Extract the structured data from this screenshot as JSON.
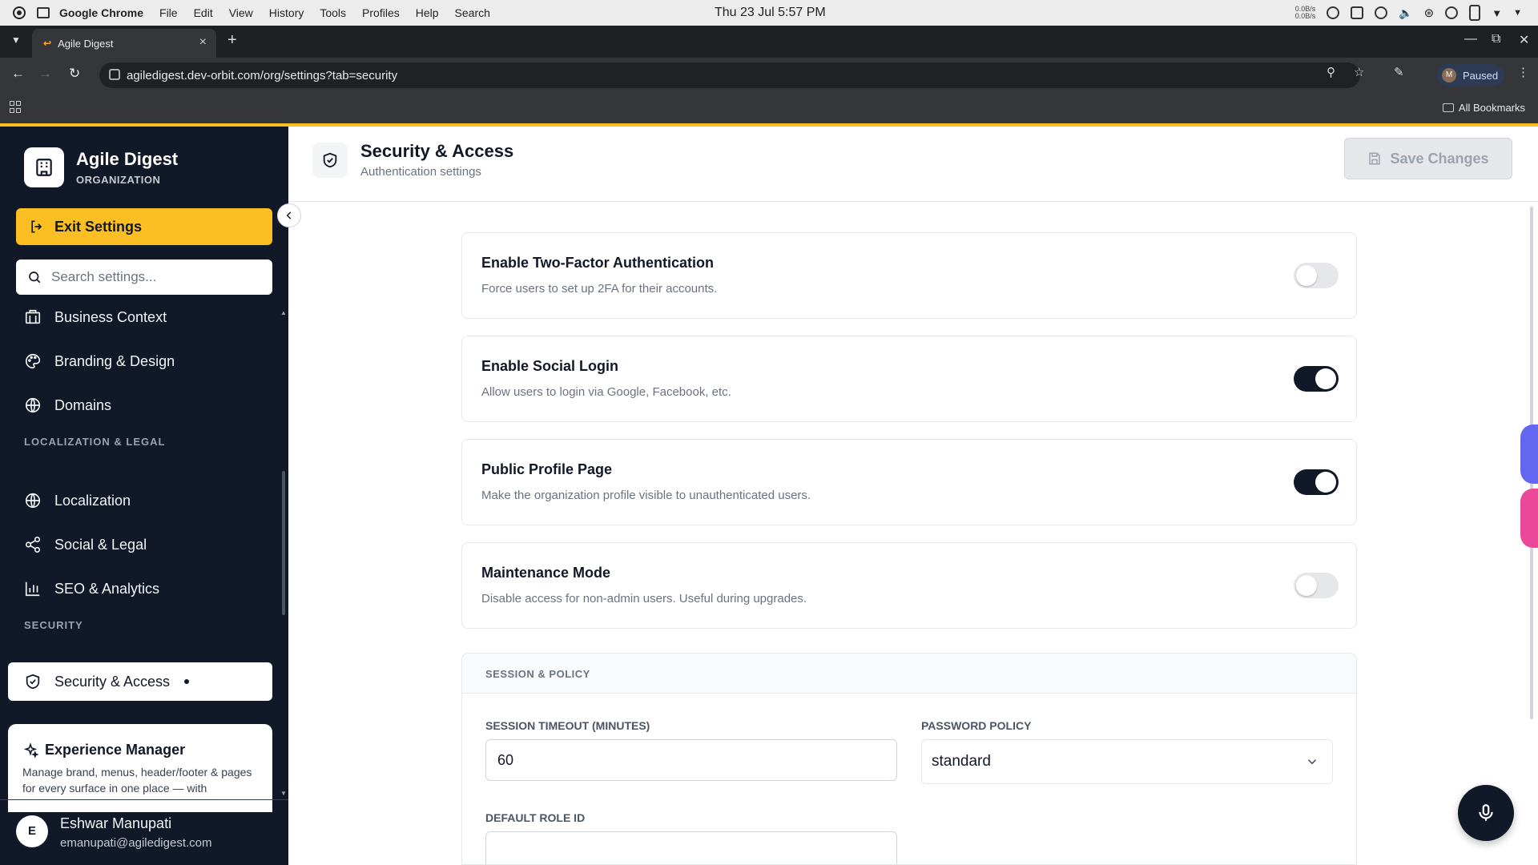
{
  "os": {
    "app_name": "Google Chrome",
    "menu": [
      "File",
      "Edit",
      "View",
      "History",
      "Tools",
      "Profiles",
      "Help",
      "Search"
    ],
    "clock": "Thu 23 Jul  5:57 PM",
    "net_up": "0.0B/s",
    "net_down": "0.0B/s"
  },
  "browser": {
    "tab_title": "Agile Digest",
    "url": "agiledigest.dev-orbit.com/org/settings?tab=security",
    "profile_initial": "M",
    "profile_status": "Paused",
    "bookmarks_label": "All Bookmarks"
  },
  "sidebar": {
    "org_name": "Agile Digest",
    "org_type": "ORGANIZATION",
    "exit_label": "Exit Settings",
    "search_placeholder": "Search settings...",
    "items_top": [
      {
        "label": "Business Context",
        "icon": "building-icon"
      },
      {
        "label": "Branding & Design",
        "icon": "palette-icon"
      },
      {
        "label": "Domains",
        "icon": "globe-icon"
      }
    ],
    "section_localization": "LOCALIZATION & LEGAL",
    "items_localization": [
      {
        "label": "Localization",
        "icon": "globe-icon"
      },
      {
        "label": "Social & Legal",
        "icon": "share-icon"
      },
      {
        "label": "SEO & Analytics",
        "icon": "bar-chart-icon"
      }
    ],
    "section_security": "SECURITY",
    "active_item": {
      "label": "Security & Access",
      "icon": "shield-check-icon"
    },
    "experience": {
      "title": "Experience Manager",
      "description": "Manage brand, menus, header/footer & pages for every surface in one place — with"
    },
    "user": {
      "initial": "E",
      "name": "Eshwar Manupati",
      "email": "emanupati@agiledigest.com"
    }
  },
  "header": {
    "title": "Security & Access",
    "subtitle": "Authentication settings",
    "save_label": "Save Changes"
  },
  "settings": [
    {
      "title": "Enable Two-Factor Authentication",
      "description": "Force users to set up 2FA for their accounts.",
      "enabled": false
    },
    {
      "title": "Enable Social Login",
      "description": "Allow users to login via Google, Facebook, etc.",
      "enabled": true
    },
    {
      "title": "Public Profile Page",
      "description": "Make the organization profile visible to unauthenticated users.",
      "enabled": true
    },
    {
      "title": "Maintenance Mode",
      "description": "Disable access for non-admin users. Useful during upgrades.",
      "enabled": false
    }
  ],
  "policy": {
    "section_title": "SESSION & POLICY",
    "session_timeout_label": "SESSION TIMEOUT (MINUTES)",
    "session_timeout_value": "60",
    "password_policy_label": "PASSWORD POLICY",
    "password_policy_value": "standard",
    "default_role_label": "DEFAULT ROLE ID",
    "default_role_value": ""
  },
  "colors": {
    "accent": "#fbbf24",
    "sidebar_bg": "#111827",
    "toggle_on": "#111827",
    "toggle_off": "#e5e7eb",
    "side_pill_blue": "#6366f1",
    "side_pill_pink": "#ec4899"
  }
}
